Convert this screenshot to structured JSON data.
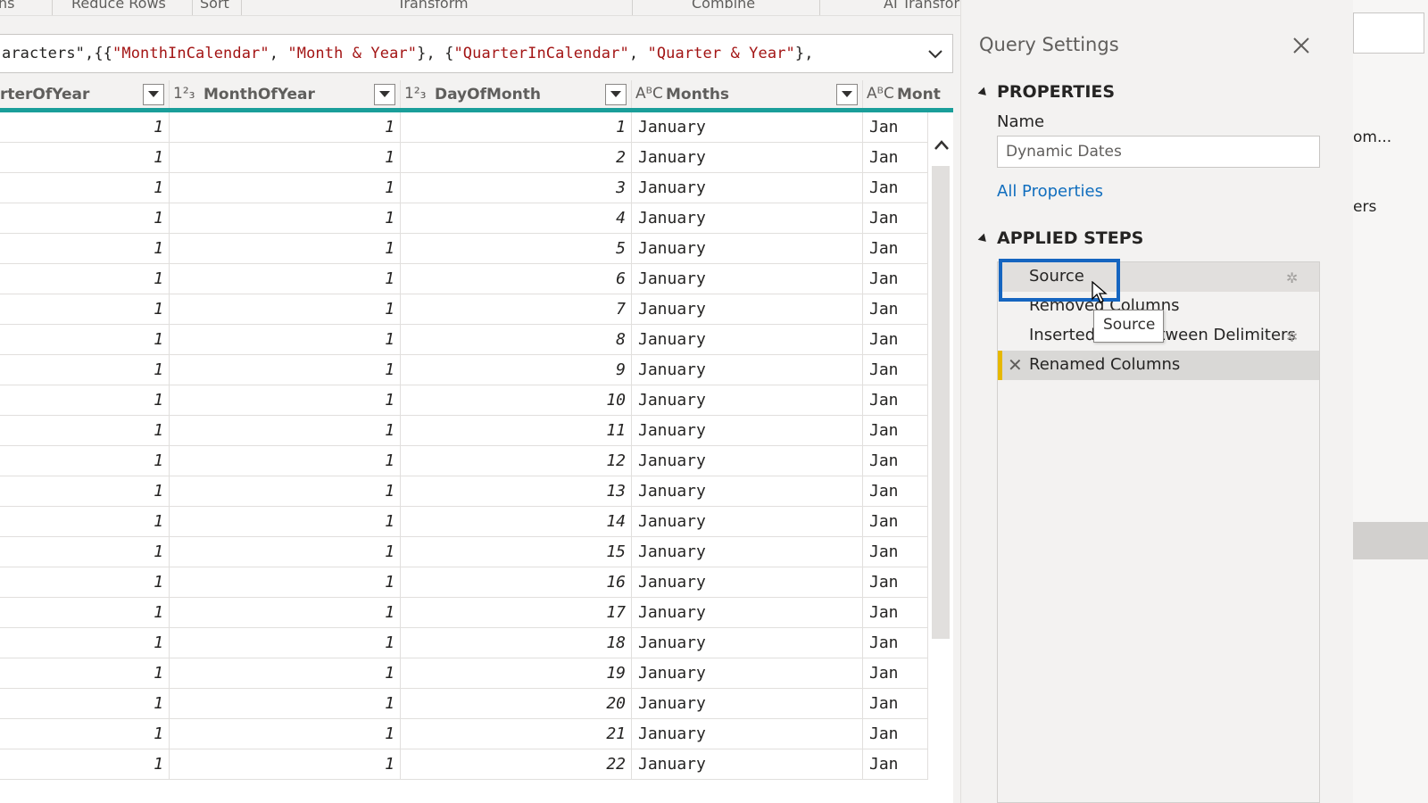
{
  "ribbon": {
    "groups": [
      "ns",
      "Reduce Rows",
      "Sort",
      "Transform",
      "Combine",
      "AI Transforms"
    ]
  },
  "formula": {
    "prefix": "aracters\",{{",
    "s1": "\"MonthInCalendar\"",
    "m1": ", ",
    "s2": "\"Month & Year\"",
    "m2": "}, {",
    "s3": "\"QuarterInCalendar\"",
    "m3": ", ",
    "s4": "\"Quarter & Year\"",
    "suffix": "},"
  },
  "columns": [
    {
      "type": "",
      "name": "rterOfYear"
    },
    {
      "type": "1²₃",
      "name": "MonthOfYear"
    },
    {
      "type": "1²₃",
      "name": "DayOfMonth"
    },
    {
      "type": "AᴮC",
      "name": "Months"
    },
    {
      "type": "AᴮC",
      "name": "Mont"
    }
  ],
  "rows": [
    [
      "1",
      "1",
      "1",
      "January",
      "Jan"
    ],
    [
      "1",
      "1",
      "2",
      "January",
      "Jan"
    ],
    [
      "1",
      "1",
      "3",
      "January",
      "Jan"
    ],
    [
      "1",
      "1",
      "4",
      "January",
      "Jan"
    ],
    [
      "1",
      "1",
      "5",
      "January",
      "Jan"
    ],
    [
      "1",
      "1",
      "6",
      "January",
      "Jan"
    ],
    [
      "1",
      "1",
      "7",
      "January",
      "Jan"
    ],
    [
      "1",
      "1",
      "8",
      "January",
      "Jan"
    ],
    [
      "1",
      "1",
      "9",
      "January",
      "Jan"
    ],
    [
      "1",
      "1",
      "10",
      "January",
      "Jan"
    ],
    [
      "1",
      "1",
      "11",
      "January",
      "Jan"
    ],
    [
      "1",
      "1",
      "12",
      "January",
      "Jan"
    ],
    [
      "1",
      "1",
      "13",
      "January",
      "Jan"
    ],
    [
      "1",
      "1",
      "14",
      "January",
      "Jan"
    ],
    [
      "1",
      "1",
      "15",
      "January",
      "Jan"
    ],
    [
      "1",
      "1",
      "16",
      "January",
      "Jan"
    ],
    [
      "1",
      "1",
      "17",
      "January",
      "Jan"
    ],
    [
      "1",
      "1",
      "18",
      "January",
      "Jan"
    ],
    [
      "1",
      "1",
      "19",
      "January",
      "Jan"
    ],
    [
      "1",
      "1",
      "20",
      "January",
      "Jan"
    ],
    [
      "1",
      "1",
      "21",
      "January",
      "Jan"
    ],
    [
      "1",
      "1",
      "22",
      "January",
      "Jan"
    ]
  ],
  "query_settings": {
    "title": "Query Settings",
    "properties_heading": "PROPERTIES",
    "name_label": "Name",
    "name_value": "Dynamic Dates",
    "all_properties": "All Properties",
    "applied_steps_heading": "APPLIED STEPS",
    "steps": [
      "Source",
      "Removed Columns",
      "Inserted Text Between Delimiters",
      "Renamed Columns"
    ],
    "tooltip": "Source"
  },
  "background_panel": {
    "text1": "om...",
    "text2": "ers"
  },
  "colors": {
    "header_accent": "#1a9e9a",
    "selection_outline": "#1565c0",
    "current_step_marker": "#e6b800",
    "link": "#106ebe",
    "formula_string": "#a31515"
  }
}
